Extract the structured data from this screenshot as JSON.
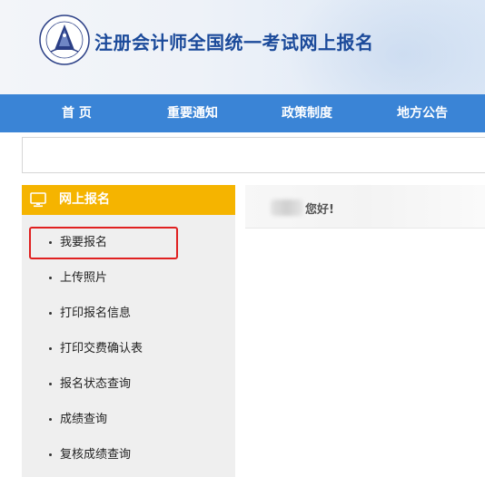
{
  "header": {
    "title": "注册会计师全国统一考试网上报名",
    "logo_icon": "cicpa-seal-logo"
  },
  "nav": {
    "items": [
      "首 页",
      "重要通知",
      "政策制度",
      "地方公告"
    ],
    "background": "#3a84d6"
  },
  "search": {
    "value": ""
  },
  "sidebar": {
    "title": "网上报名",
    "icon": "monitor-icon",
    "header_color": "#f5b400",
    "items": [
      {
        "label": "我要报名"
      },
      {
        "label": "上传照片"
      },
      {
        "label": "打印报名信息"
      },
      {
        "label": "打印交费确认表"
      },
      {
        "label": "报名状态查询"
      },
      {
        "label": "成绩查询"
      },
      {
        "label": "复核成绩查询"
      }
    ]
  },
  "main": {
    "greeting": "您好!"
  },
  "annotation": {
    "highlight_color": "#e02020"
  }
}
